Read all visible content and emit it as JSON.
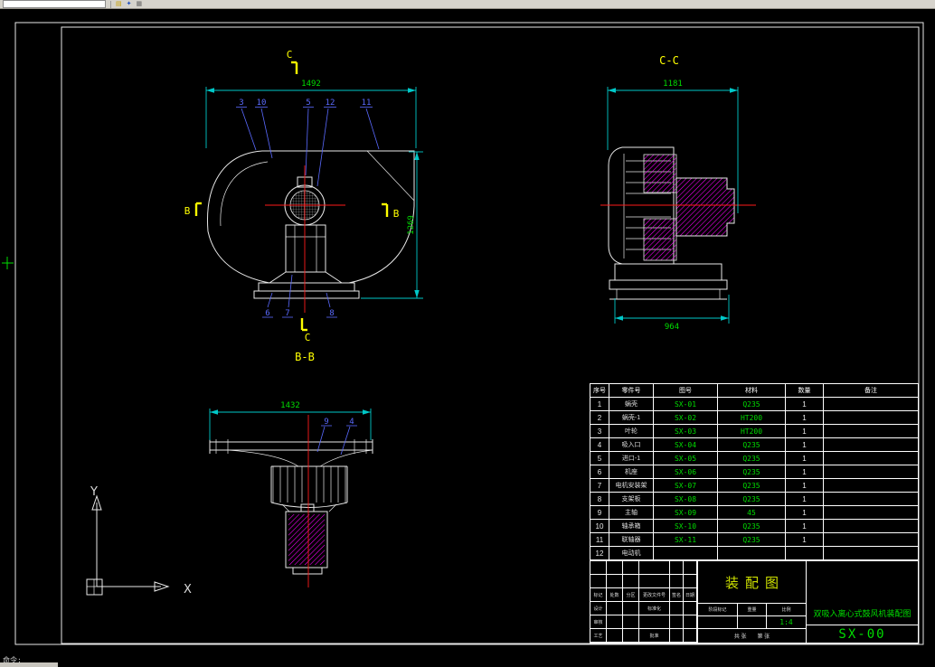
{
  "toolbar": {
    "icons": [
      {
        "name": "open-icon",
        "glyph": "▤"
      },
      {
        "name": "favorites-icon",
        "glyph": "✦"
      },
      {
        "name": "grid-icon",
        "glyph": "▦"
      }
    ]
  },
  "status": {
    "command_line": "命令:"
  },
  "views": {
    "section_bb": {
      "label": "B-B",
      "cut_label_top": "C",
      "cut_label_bottom": "C",
      "side_label_left": "B",
      "side_label_right": "B",
      "dim_width": "1492",
      "dim_height": "1269",
      "balloons_top": [
        "3",
        "10",
        "5",
        "12",
        "11"
      ],
      "balloons_bottom": [
        "6",
        "7",
        "8"
      ]
    },
    "section_cc": {
      "label": "C-C",
      "dim_top": "1181",
      "dim_bottom": "964"
    },
    "plan": {
      "dim_top": "1432",
      "balloons": [
        "9",
        "4"
      ]
    },
    "ucs": {
      "x_label": "X",
      "y_label": "Y"
    }
  },
  "bom": {
    "headers": [
      "序号",
      "零件号",
      "图号",
      "材料",
      "数量",
      "备注"
    ],
    "rows": [
      [
        "1",
        "蜗壳",
        "SX-01",
        "Q235",
        "1",
        ""
      ],
      [
        "2",
        "蜗壳-1",
        "SX-02",
        "HT200",
        "1",
        ""
      ],
      [
        "3",
        "叶轮",
        "SX-03",
        "HT200",
        "1",
        ""
      ],
      [
        "4",
        "吸入口",
        "SX-04",
        "Q235",
        "1",
        ""
      ],
      [
        "5",
        "进口-1",
        "SX-05",
        "Q235",
        "1",
        ""
      ],
      [
        "6",
        "机座",
        "SX-06",
        "Q235",
        "1",
        ""
      ],
      [
        "7",
        "电机安装架",
        "SX-07",
        "Q235",
        "1",
        ""
      ],
      [
        "8",
        "支架板",
        "SX-08",
        "Q235",
        "1",
        ""
      ],
      [
        "9",
        "主轴",
        "SX-09",
        "45",
        "1",
        ""
      ],
      [
        "10",
        "轴承箱",
        "SX-10",
        "Q235",
        "1",
        ""
      ],
      [
        "11",
        "联轴器",
        "SX-11",
        "Q235",
        "1",
        ""
      ],
      [
        "12",
        "电动机",
        "",
        "",
        "",
        ""
      ]
    ]
  },
  "title_block": {
    "title": "装配图",
    "product_name": "双吸入离心式鼓风机装配图",
    "drawing_number": "SX-00",
    "scale_value": "1:4",
    "labels": {
      "mark": "标记",
      "count": "处数",
      "zone": "分区",
      "change_doc": "更改文件号",
      "sign": "签名",
      "date": "日期",
      "design": "设计",
      "standard": "标准化",
      "check": "审核",
      "process": "工艺",
      "approve": "批准",
      "stage_mark": "阶段标记",
      "weight": "重量",
      "scale": "比例",
      "sheets": "共 张",
      "sheet": "第 张"
    }
  },
  "colors": {
    "outline": "#e8e8e8",
    "dimension_line": "#00c8c8",
    "dimension_text": "#00dd00",
    "balloon": "#5a6aff",
    "section_label": "#ffff00",
    "centerline": "#ff1a1a",
    "hatch": "#ff00ff",
    "table_accent": "#00dd00",
    "title_accent": "#cde000"
  }
}
